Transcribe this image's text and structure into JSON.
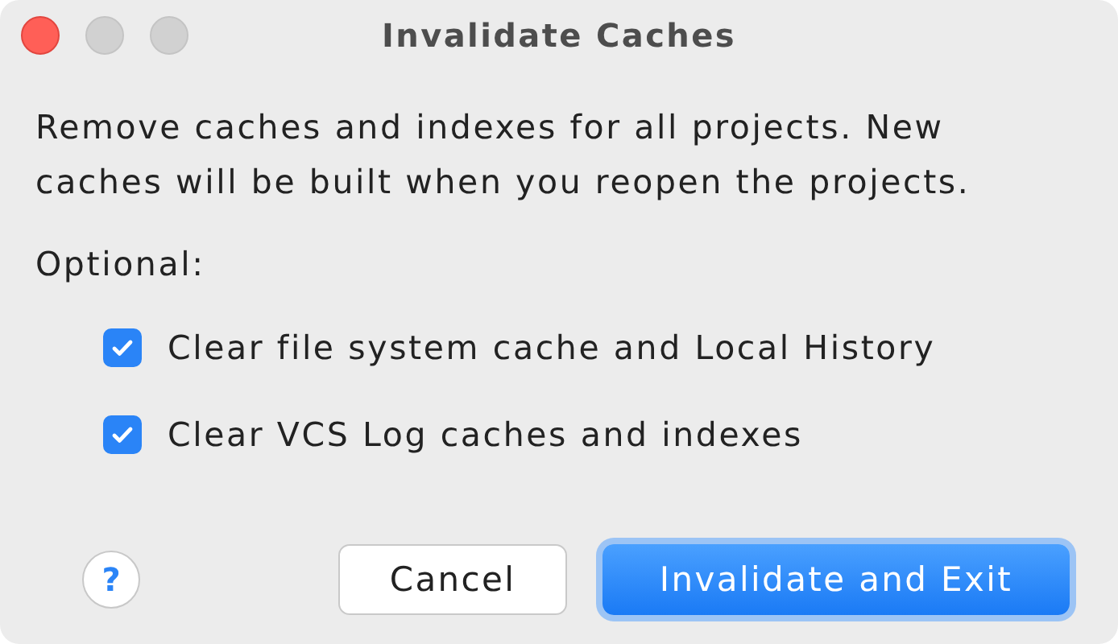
{
  "window": {
    "title": "Invalidate Caches"
  },
  "message": "Remove caches and indexes for all projects. New caches will be built when you reopen the projects.",
  "optional_label": "Optional:",
  "options": [
    {
      "label": "Clear file system cache and Local History",
      "checked": true
    },
    {
      "label": "Clear VCS Log caches and indexes",
      "checked": true
    }
  ],
  "help": "?",
  "buttons": [
    {
      "label": "Cancel",
      "kind": "secondary"
    },
    {
      "label": "Invalidate and Exit",
      "kind": "primary"
    }
  ]
}
